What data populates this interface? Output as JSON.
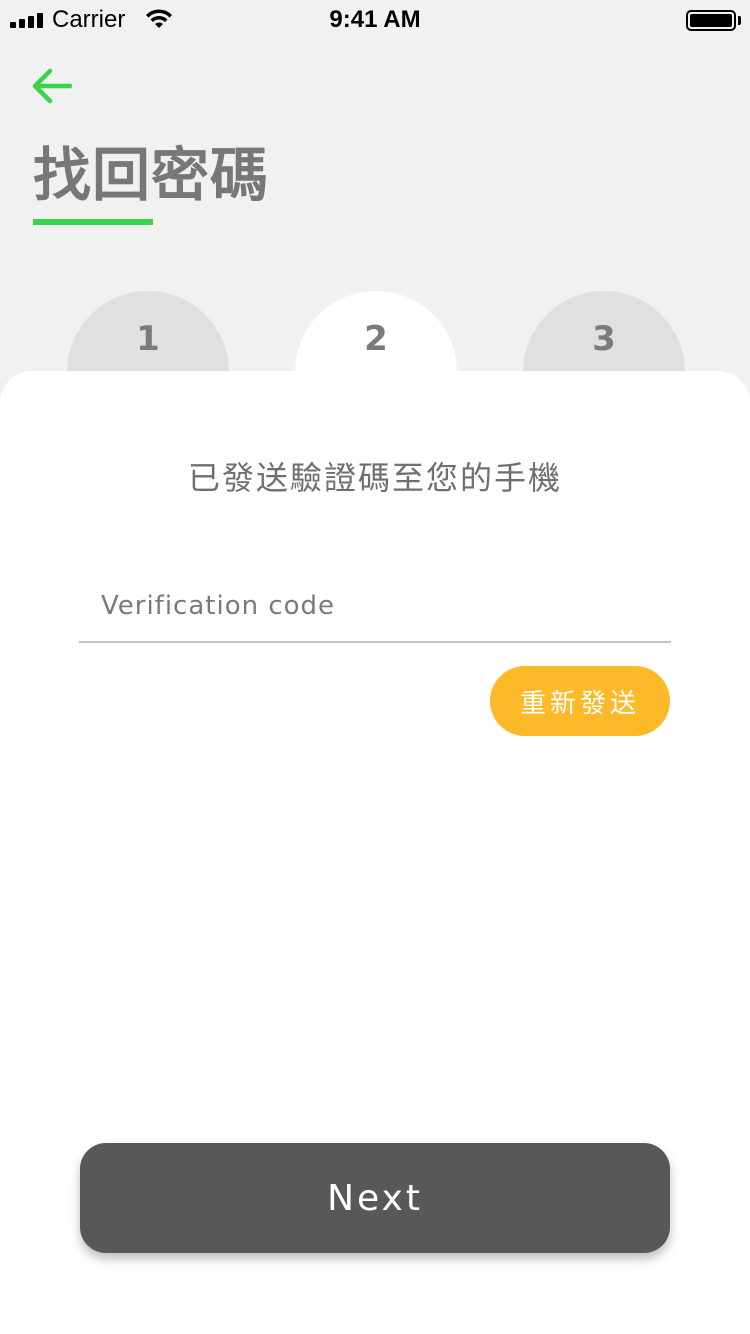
{
  "status_bar": {
    "carrier": "Carrier",
    "time": "9:41 AM"
  },
  "header": {
    "back_icon": "arrow-left-icon",
    "title": "找回密碼"
  },
  "steps": [
    {
      "number": "1",
      "active": false
    },
    {
      "number": "2",
      "active": true
    },
    {
      "number": "3",
      "active": false
    }
  ],
  "form": {
    "message": "已發送驗證碼至您的手機",
    "code_placeholder": "Verification code",
    "code_value": "",
    "resend_label": "重新發送",
    "next_label": "Next"
  },
  "colors": {
    "accent_green": "#3ad34c",
    "resend_yellow": "#fcb928",
    "next_button": "#585858"
  }
}
